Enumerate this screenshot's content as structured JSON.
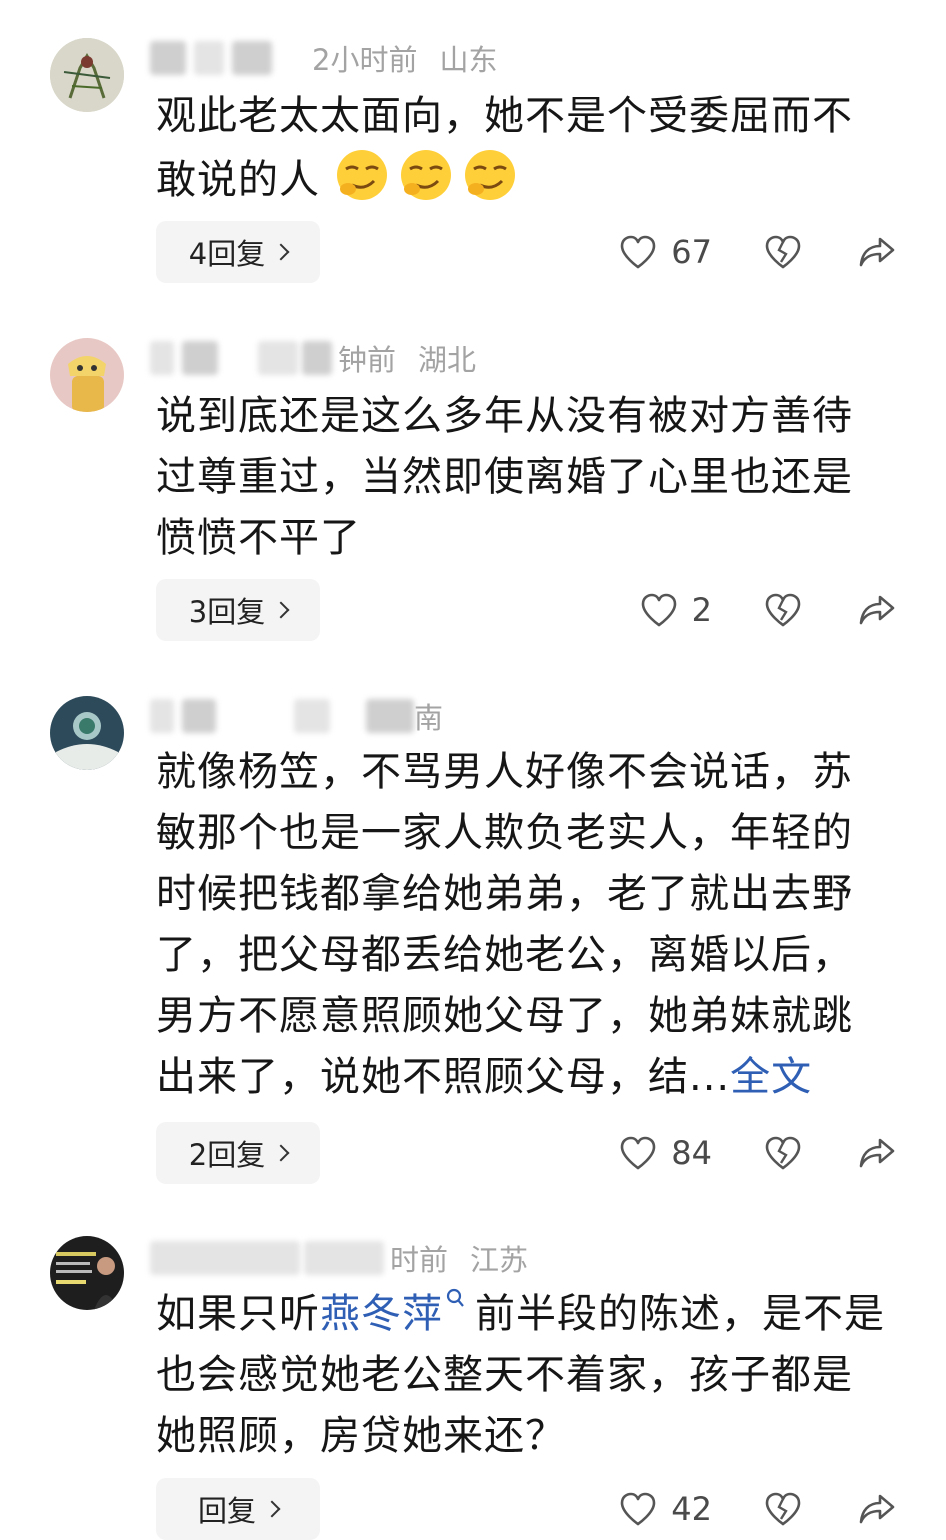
{
  "comments": [
    {
      "time": "2小时前",
      "location": "山东",
      "text": "观此老太太面向，她不是个受委屈而不敢说的人",
      "reply_label": "4回复",
      "likes": "67"
    },
    {
      "time": "钟前",
      "location": "湖北",
      "text": "说到底还是这么多年从没有被对方善待过尊重过，当然即使离婚了心里也还是愤愤不平了",
      "reply_label": "3回复",
      "likes": "2"
    },
    {
      "time": "南",
      "location": "",
      "text": "就像杨笠，不骂男人好像不会说话，苏敏那个也是一家人欺负老实人，年轻的时候把钱都拿给她弟弟，老了就出去野了，把父母都丢给她老公，离婚以后，男方不愿意照顾她父母了，她弟妹就跳出来了，说她不照顾父母，结...",
      "more_label": "全文",
      "reply_label": "2回复",
      "likes": "84"
    },
    {
      "time": "时前",
      "location": "江苏",
      "text_before": "如果只听",
      "link_text": "燕冬萍",
      "text_after": "前半段的陈述，是不是也会感觉她老公整天不着家，孩子都是她照顾，房贷她来还？",
      "reply_label": "回复",
      "likes": "42"
    }
  ],
  "icons": {
    "like": "heart-outline-icon",
    "dislike": "broken-heart-icon",
    "share": "share-arrow-icon",
    "emoji": "smirking-face-emoji"
  },
  "colors": {
    "link": "#2f5fb5",
    "meta": "#9a9a9a",
    "reply_bg": "#f4f4f4"
  }
}
